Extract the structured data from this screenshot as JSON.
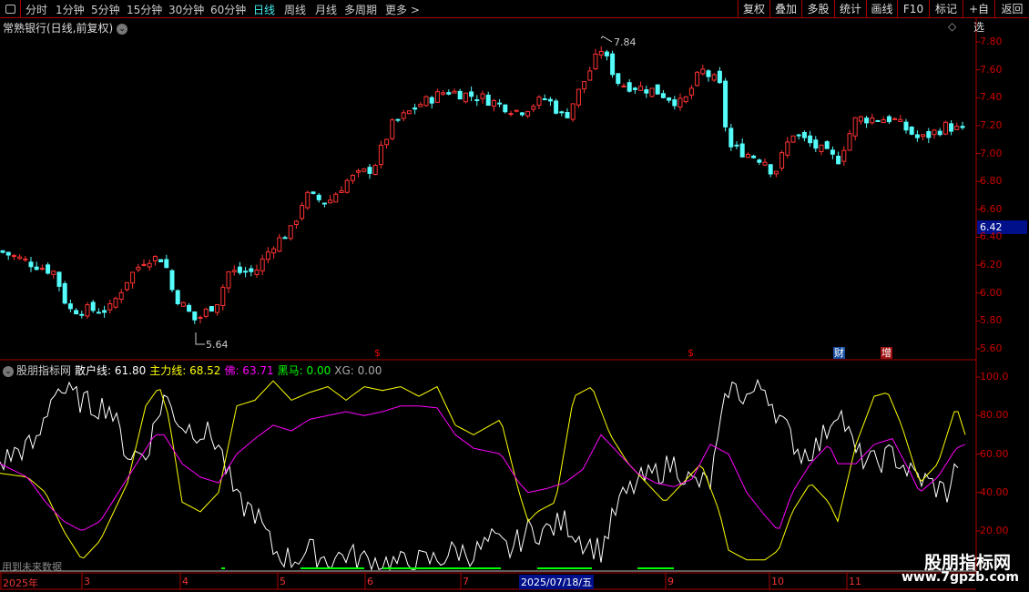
{
  "toolbar": {
    "periods": [
      "分时",
      "1分钟",
      "5分钟",
      "15分钟",
      "30分钟",
      "60分钟",
      "日线",
      "周线",
      "月线",
      "多周期",
      "更多 >"
    ],
    "active": "日线",
    "actions": [
      "复权",
      "叠加",
      "多股",
      "统计",
      "画线",
      "F10",
      "标记",
      "+自选",
      "返回"
    ]
  },
  "title": "常熟银行(日线,前复权)",
  "price_panel": {
    "max_label": "7.84",
    "min_label": "5.64",
    "current_price": "6.42",
    "axis": [
      "7.80",
      "7.60",
      "7.40",
      "7.20",
      "7.00",
      "6.80",
      "6.60",
      "6.40",
      "6.20",
      "6.00",
      "5.80",
      "5.60"
    ],
    "markers": [
      {
        "t": "$",
        "c": "#e00"
      },
      {
        "t": "$",
        "c": "#e00"
      },
      {
        "t": "财",
        "c": "#5af"
      },
      {
        "t": "增",
        "c": "#f44"
      }
    ]
  },
  "indicator": {
    "name": "股朋指标网",
    "lines": [
      {
        "label": "散户线: 61.80",
        "color": "#ffffff"
      },
      {
        "label": "主力线: 68.52",
        "color": "#ffff00"
      },
      {
        "label": "佛: 63.71",
        "color": "#ff00ff"
      },
      {
        "label": "黑马: 0.00",
        "color": "#00ff00"
      },
      {
        "label": "XG: 0.00",
        "color": "#aaaaaa"
      }
    ],
    "axis": [
      "100.0",
      "80.00",
      "60.00",
      "40.00",
      "20.00"
    ],
    "note": "用到未来数据"
  },
  "dates": {
    "labels": [
      "2025年",
      "3",
      "4",
      "5",
      "6",
      "7",
      "9",
      "10",
      "11"
    ],
    "selected": "2025/07/18/五"
  },
  "watermark": {
    "line1": "股朋指标网",
    "line2": "www.7gpzb.com"
  },
  "chart_data": [
    {
      "type": "candlestick",
      "title": "常熟银行 日线",
      "ylim": [
        5.6,
        7.8
      ],
      "close_path": [
        [
          0,
          6.3
        ],
        [
          60,
          6.15
        ],
        [
          75,
          5.88
        ],
        [
          120,
          5.88
        ],
        [
          140,
          6.1
        ],
        [
          160,
          6.25
        ],
        [
          180,
          6.25
        ],
        [
          190,
          6.0
        ],
        [
          215,
          5.8
        ],
        [
          240,
          5.95
        ],
        [
          250,
          6.15
        ],
        [
          280,
          6.15
        ],
        [
          300,
          6.35
        ],
        [
          320,
          6.45
        ],
        [
          335,
          6.7
        ],
        [
          360,
          6.65
        ],
        [
          380,
          6.8
        ],
        [
          410,
          6.9
        ],
        [
          430,
          7.2
        ],
        [
          460,
          7.35
        ],
        [
          490,
          7.45
        ],
        [
          530,
          7.4
        ],
        [
          570,
          7.3
        ],
        [
          600,
          7.4
        ],
        [
          620,
          7.25
        ],
        [
          640,
          7.5
        ],
        [
          660,
          7.75
        ],
        [
          680,
          7.5
        ],
        [
          720,
          7.45
        ],
        [
          750,
          7.35
        ],
        [
          770,
          7.6
        ],
        [
          790,
          7.5
        ],
        [
          800,
          7.05
        ],
        [
          840,
          6.95
        ],
        [
          850,
          6.85
        ],
        [
          870,
          7.15
        ],
        [
          920,
          6.95
        ],
        [
          940,
          7.25
        ],
        [
          980,
          7.25
        ],
        [
          1010,
          7.1
        ],
        [
          1040,
          7.2
        ],
        [
          1060,
          7.15
        ]
      ]
    },
    {
      "type": "line",
      "ylim": [
        0,
        100
      ],
      "series": [
        {
          "name": "散户线",
          "color": "#ffffff",
          "path": [
            [
              0,
              55
            ],
            [
              20,
              62
            ],
            [
              40,
              65
            ],
            [
              60,
              95
            ],
            [
              80,
              90
            ],
            [
              100,
              85
            ],
            [
              120,
              85
            ],
            [
              140,
              60
            ],
            [
              160,
              60
            ],
            [
              180,
              90
            ],
            [
              200,
              75
            ],
            [
              230,
              70
            ],
            [
              240,
              65
            ],
            [
              260,
              35
            ],
            [
              280,
              30
            ],
            [
              300,
              10
            ],
            [
              320,
              5
            ],
            [
              340,
              10
            ],
            [
              360,
              5
            ],
            [
              380,
              8
            ],
            [
              400,
              5
            ],
            [
              440,
              3
            ],
            [
              480,
              5
            ],
            [
              500,
              10
            ],
            [
              520,
              8
            ],
            [
              540,
              15
            ],
            [
              560,
              10
            ],
            [
              580,
              20
            ],
            [
              600,
              20
            ],
            [
              620,
              25
            ],
            [
              640,
              15
            ],
            [
              660,
              10
            ],
            [
              680,
              35
            ],
            [
              700,
              45
            ],
            [
              720,
              50
            ],
            [
              740,
              55
            ],
            [
              760,
              45
            ],
            [
              780,
              45
            ],
            [
              800,
              95
            ],
            [
              820,
              90
            ],
            [
              840,
              95
            ],
            [
              860,
              75
            ],
            [
              880,
              60
            ],
            [
              900,
              65
            ],
            [
              920,
              85
            ],
            [
              940,
              60
            ],
            [
              960,
              55
            ],
            [
              980,
              60
            ],
            [
              1000,
              50
            ],
            [
              1020,
              45
            ],
            [
              1040,
              40
            ],
            [
              1055,
              60
            ]
          ]
        },
        {
          "name": "主力线",
          "color": "#ffff00",
          "path": [
            [
              0,
              50
            ],
            [
              30,
              48
            ],
            [
              50,
              40
            ],
            [
              70,
              20
            ],
            [
              90,
              5
            ],
            [
              110,
              15
            ],
            [
              120,
              25
            ],
            [
              140,
              45
            ],
            [
              160,
              85
            ],
            [
              175,
              95
            ],
            [
              185,
              80
            ],
            [
              200,
              35
            ],
            [
              220,
              30
            ],
            [
              240,
              40
            ],
            [
              260,
              85
            ],
            [
              280,
              88
            ],
            [
              300,
              98
            ],
            [
              320,
              88
            ],
            [
              340,
              92
            ],
            [
              360,
              95
            ],
            [
              380,
              88
            ],
            [
              400,
              95
            ],
            [
              420,
              93
            ],
            [
              440,
              95
            ],
            [
              460,
              90
            ],
            [
              480,
              95
            ],
            [
              500,
              75
            ],
            [
              520,
              70
            ],
            [
              550,
              78
            ],
            [
              570,
              40
            ],
            [
              580,
              25
            ],
            [
              590,
              30
            ],
            [
              610,
              35
            ],
            [
              630,
              90
            ],
            [
              650,
              95
            ],
            [
              670,
              70
            ],
            [
              690,
              55
            ],
            [
              710,
              45
            ],
            [
              730,
              35
            ],
            [
              750,
              45
            ],
            [
              770,
              55
            ],
            [
              790,
              30
            ],
            [
              800,
              10
            ],
            [
              820,
              5
            ],
            [
              840,
              5
            ],
            [
              855,
              10
            ],
            [
              870,
              30
            ],
            [
              890,
              45
            ],
            [
              910,
              35
            ],
            [
              920,
              25
            ],
            [
              940,
              65
            ],
            [
              960,
              90
            ],
            [
              975,
              92
            ],
            [
              990,
              75
            ],
            [
              1010,
              45
            ],
            [
              1030,
              55
            ],
            [
              1050,
              85
            ],
            [
              1060,
              70
            ]
          ]
        },
        {
          "name": "佛",
          "color": "#ff00ff",
          "path": [
            [
              0,
              55
            ],
            [
              30,
              48
            ],
            [
              50,
              35
            ],
            [
              70,
              25
            ],
            [
              90,
              20
            ],
            [
              110,
              25
            ],
            [
              130,
              40
            ],
            [
              150,
              55
            ],
            [
              170,
              70
            ],
            [
              180,
              70
            ],
            [
              200,
              55
            ],
            [
              220,
              48
            ],
            [
              240,
              45
            ],
            [
              260,
              60
            ],
            [
              280,
              68
            ],
            [
              300,
              75
            ],
            [
              320,
              72
            ],
            [
              340,
              78
            ],
            [
              360,
              80
            ],
            [
              380,
              82
            ],
            [
              400,
              80
            ],
            [
              420,
              82
            ],
            [
              440,
              85
            ],
            [
              460,
              85
            ],
            [
              480,
              84
            ],
            [
              500,
              70
            ],
            [
              520,
              63
            ],
            [
              550,
              60
            ],
            [
              570,
              45
            ],
            [
              580,
              40
            ],
            [
              600,
              42
            ],
            [
              620,
              45
            ],
            [
              640,
              52
            ],
            [
              660,
              70
            ],
            [
              680,
              60
            ],
            [
              700,
              50
            ],
            [
              720,
              45
            ],
            [
              740,
              43
            ],
            [
              760,
              47
            ],
            [
              780,
              65
            ],
            [
              800,
              60
            ],
            [
              820,
              40
            ],
            [
              840,
              28
            ],
            [
              855,
              20
            ],
            [
              870,
              40
            ],
            [
              890,
              55
            ],
            [
              910,
              65
            ],
            [
              920,
              55
            ],
            [
              940,
              55
            ],
            [
              960,
              65
            ],
            [
              980,
              68
            ],
            [
              1000,
              50
            ],
            [
              1010,
              40
            ],
            [
              1030,
              48
            ],
            [
              1050,
              63
            ],
            [
              1060,
              65
            ]
          ]
        }
      ]
    }
  ]
}
